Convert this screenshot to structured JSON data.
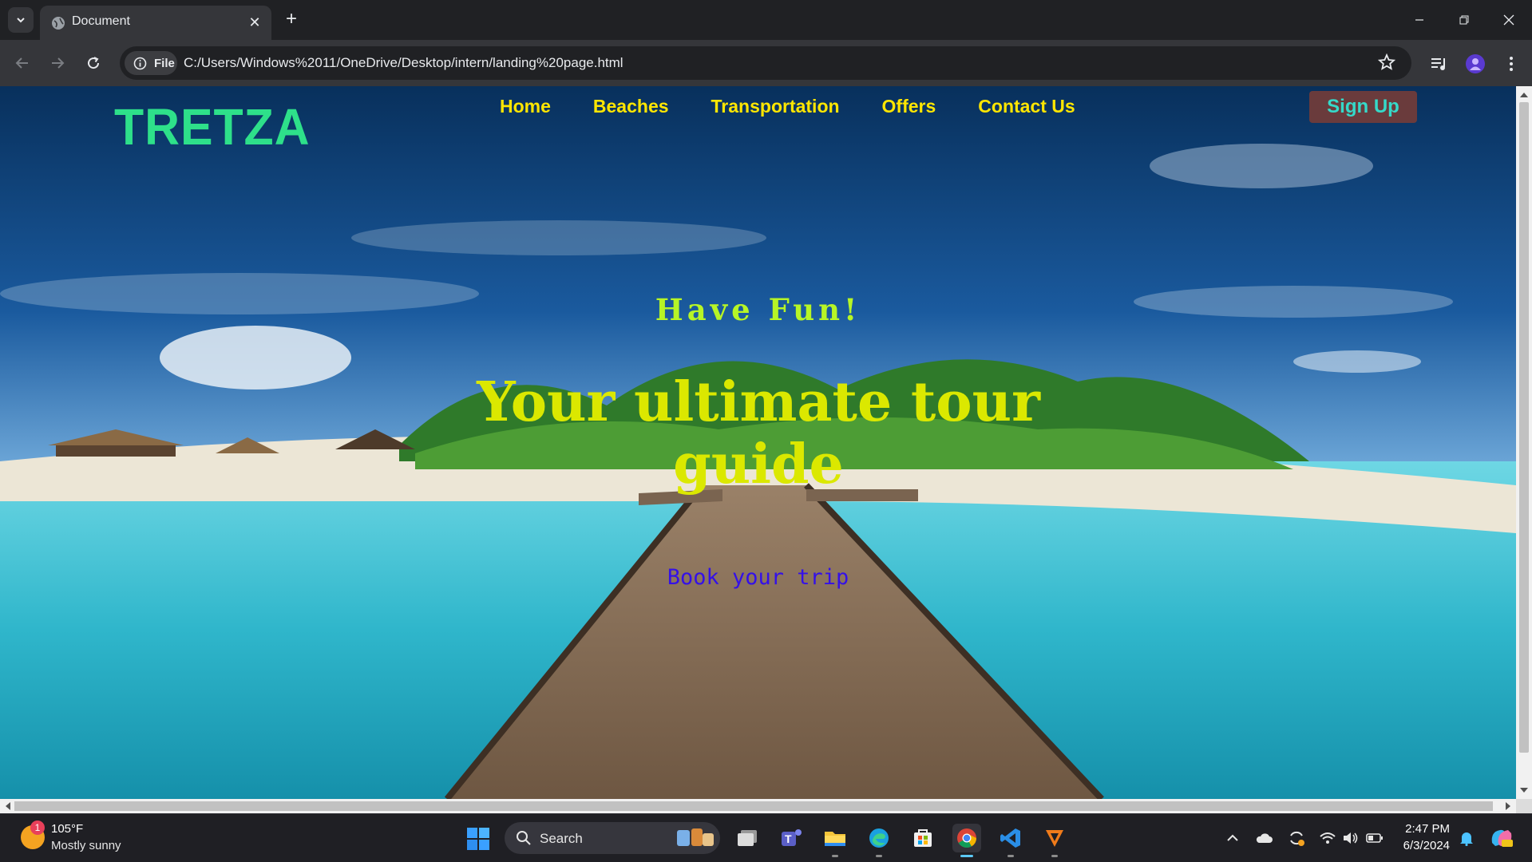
{
  "browser": {
    "tab_title": "Document",
    "address_chip_label": "File",
    "url": "C:/Users/Windows%2011/OneDrive/Desktop/intern/landing%20page.html"
  },
  "site": {
    "brand": "TRETZA",
    "nav": [
      "Home",
      "Beaches",
      "Transportation",
      "Offers",
      "Contact Us"
    ],
    "signup_label": "Sign Up",
    "hero_kicker": "Have Fun!",
    "hero_title": "Your ultimate tour guide",
    "hero_cta": "Book your trip"
  },
  "taskbar": {
    "weather_temp": "105°F",
    "weather_desc": "Mostly sunny",
    "weather_badge": "1",
    "search_label": "Search",
    "time": "2:47 PM",
    "date": "6/3/2024"
  },
  "colors": {
    "brand": "#2ee08a",
    "nav_link": "#ffe600",
    "signup_bg": "#6a3b3c",
    "signup_text": "#35d9c9",
    "hero_kicker": "#b7f526",
    "hero_title": "#dbe800",
    "hero_cta": "#3410e8"
  }
}
